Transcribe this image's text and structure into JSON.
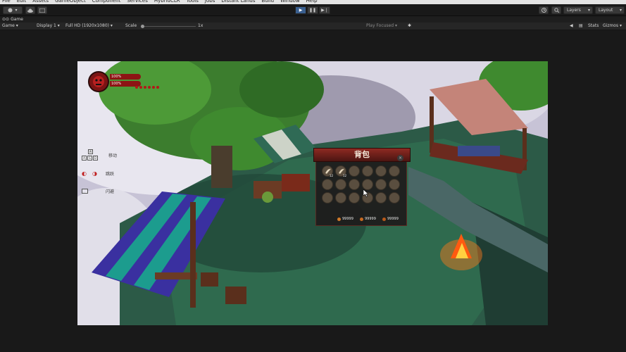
{
  "menu": [
    "File",
    "Edit",
    "Assets",
    "GameObject",
    "Component",
    "Services",
    "HybridCLR",
    "Tools",
    "Jobs",
    "Distant Lands",
    "Build",
    "Window",
    "Help"
  ],
  "toolbar": {
    "layers_label": "Layers",
    "layout_label": "Layout"
  },
  "tab": {
    "label": "Game"
  },
  "game_bar": {
    "mode": "Game",
    "display": "Display 1",
    "resolution": "Full HD (1920x1080)",
    "scale_label": "Scale",
    "scale_value": "1x",
    "play_focused": "Play Focused",
    "stats": "Stats",
    "gizmos": "Gizmos"
  },
  "hud": {
    "health_text": "100%",
    "mana_text": "100%",
    "health_pct": 100,
    "mana_pct": 100,
    "dots": 6,
    "hint_move": "移动",
    "hint_jump": "跳跃",
    "hint_dodge": "闪避",
    "keys": [
      "W",
      "A",
      "S",
      "D"
    ]
  },
  "inventory": {
    "title": "背包",
    "close": "×",
    "slots": [
      {
        "icon": "scroll-icon",
        "count": "12"
      },
      {
        "icon": "scroll-icon",
        "count": "12"
      },
      {
        "icon": "",
        "count": ""
      },
      {
        "icon": "",
        "count": ""
      },
      {
        "icon": "",
        "count": ""
      },
      {
        "icon": "",
        "count": ""
      },
      {
        "icon": "",
        "count": ""
      },
      {
        "icon": "",
        "count": ""
      },
      {
        "icon": "",
        "count": ""
      },
      {
        "icon": "",
        "count": ""
      },
      {
        "icon": "",
        "count": ""
      },
      {
        "icon": "",
        "count": ""
      },
      {
        "icon": "",
        "count": ""
      },
      {
        "icon": "",
        "count": ""
      },
      {
        "icon": "",
        "count": ""
      },
      {
        "icon": "",
        "count": ""
      },
      {
        "icon": "",
        "count": ""
      },
      {
        "icon": "",
        "count": ""
      }
    ],
    "currencies": [
      {
        "value": "99999",
        "color": "#d07a2a"
      },
      {
        "value": "99999",
        "color": "#c86a20"
      },
      {
        "value": "99999",
        "color": "#b85a1a"
      }
    ]
  },
  "colors": {
    "accent_play": "#3a5f8f",
    "hud_red": "#8d1414",
    "bag_title": "#8e2a22"
  }
}
